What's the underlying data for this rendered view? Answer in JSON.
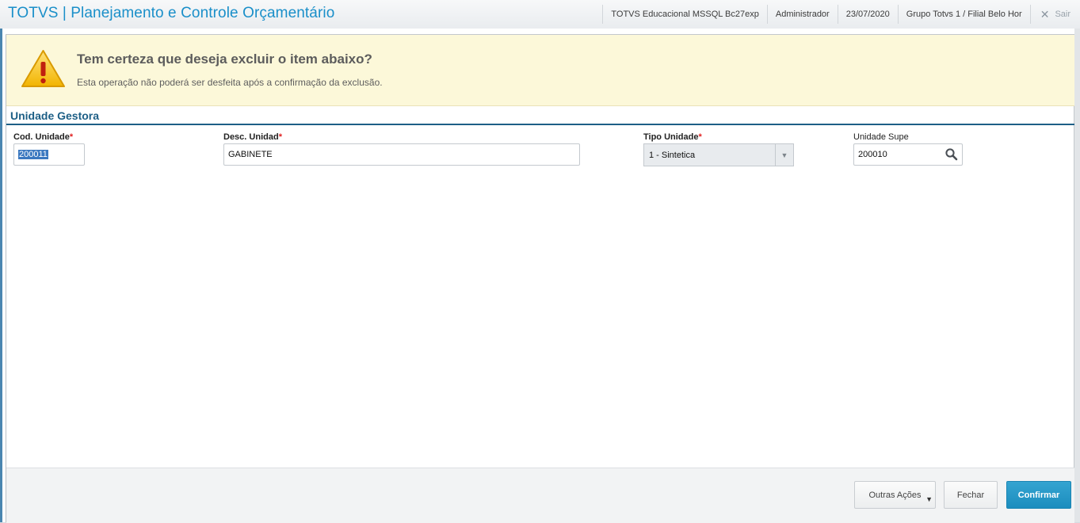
{
  "header": {
    "app_title": "TOTVS | Planejamento e Controle Orçamentário",
    "environment": "TOTVS Educacional MSSQL Bc27exp",
    "user": "Administrador",
    "date": "23/07/2020",
    "company": "Grupo Totvs 1 / Filial Belo Hor",
    "exit_label": "Sair"
  },
  "warning": {
    "title": "Tem certeza que deseja excluir o item abaixo?",
    "subtitle": "Esta operação não poderá ser desfeita após a confirmação da exclusão."
  },
  "section": {
    "title": "Unidade Gestora"
  },
  "fields": {
    "cod_unidade": {
      "label": "Cod. Unidade",
      "required_mark": "*",
      "value": "200011"
    },
    "desc_unidade": {
      "label": "Desc. Unidad",
      "required_mark": "*",
      "value": "GABINETE"
    },
    "tipo_unidade": {
      "label": "Tipo Unidade",
      "required_mark": "*",
      "value": "1 - Sintetica"
    },
    "unidade_supe": {
      "label": "Unidade Supe",
      "value": "200010"
    }
  },
  "footer": {
    "other_actions_label": "Outras Ações",
    "close_label": "Fechar",
    "confirm_label": "Confirmar"
  },
  "colors": {
    "brand": "#1a8fc9",
    "section": "#1d5f86",
    "warning_bg": "#fcf8d9",
    "primary_button": "#1c8dbe",
    "required": "#e02020"
  }
}
